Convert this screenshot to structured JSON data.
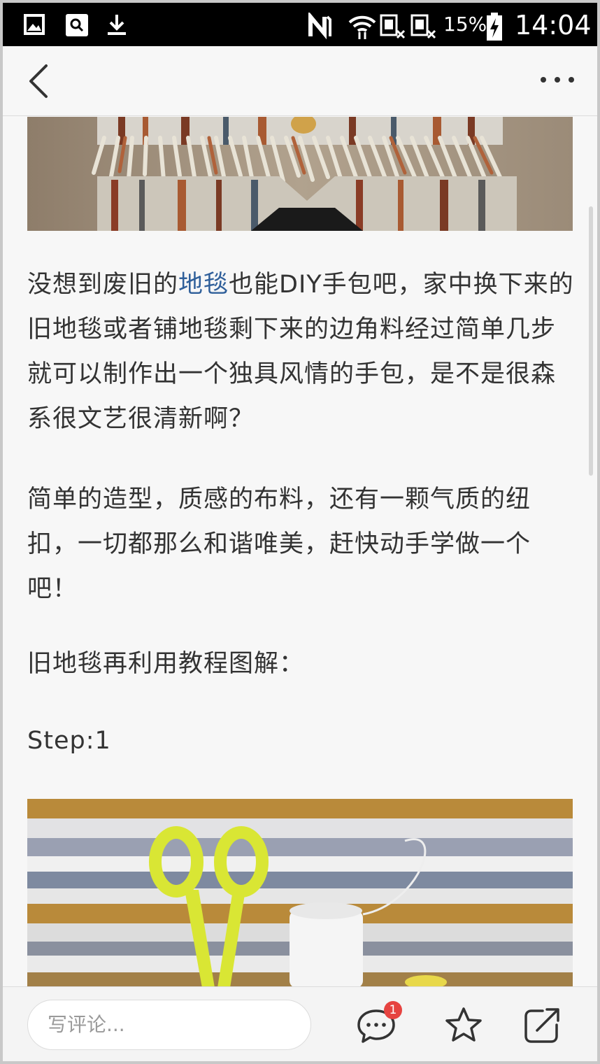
{
  "status_bar": {
    "battery_percent": "15%",
    "time": "14:04",
    "icons": [
      "gallery-icon",
      "search-icon",
      "download-icon",
      "nfc-icon",
      "wifi-icon",
      "sim1-no-signal-icon",
      "sim2-no-signal-icon",
      "battery-charging-icon"
    ]
  },
  "article": {
    "paragraph1_before_link": "没想到废旧的",
    "paragraph1_link": "地毯",
    "paragraph1_after_link": "也能DIY手包吧，家中换下来的旧地毯或者铺地毯剩下来的边角料经过简单几步就可以制作出一个独具风情的手包，是不是很森系很文艺很清新啊？",
    "paragraph2": "简单的造型，质感的布料，还有一颗气质的纽扣，一切都那么和谐唯美，赶快动手学做一个吧！",
    "paragraph3": "旧地毯再利用教程图解：",
    "paragraph4": "Step:1",
    "link_color": "#2f5f9a"
  },
  "bottom_bar": {
    "comment_placeholder": "写评论...",
    "comment_badge": "1",
    "badge_color": "#e64340"
  }
}
